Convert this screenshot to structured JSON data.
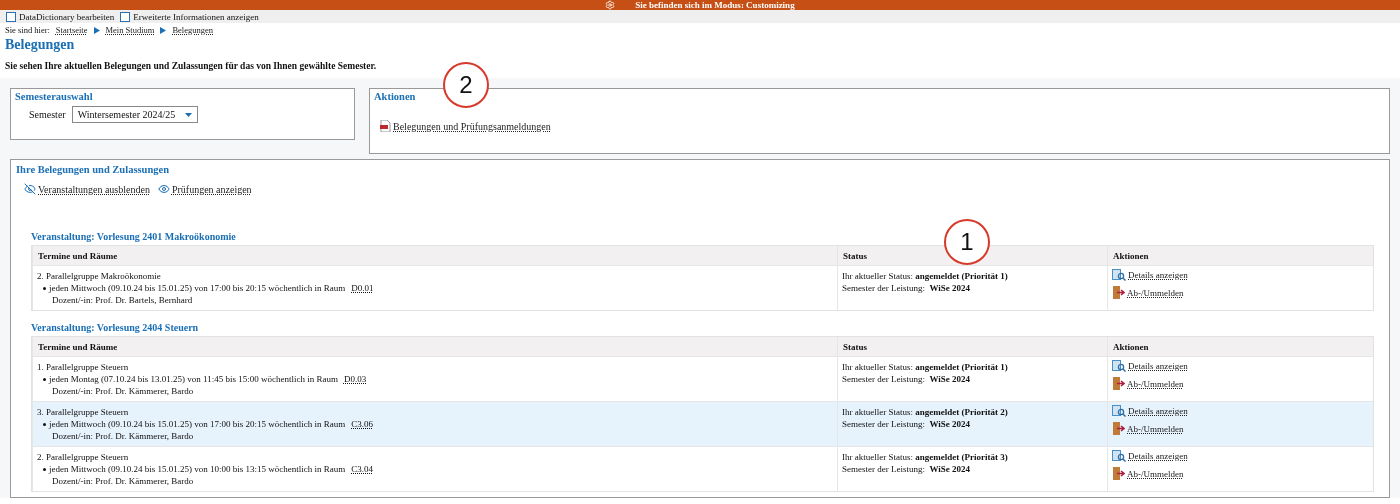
{
  "mode_bar": {
    "text": "Sie befinden sich im Modus: Customizing"
  },
  "options": [
    {
      "label": "DataDictionary bearbeiten",
      "checked": false
    },
    {
      "label": "Erweiterte Informationen anzeigen",
      "checked": false
    }
  ],
  "breadcrumb": {
    "label": "Sie sind hier:",
    "items": [
      "Startseite",
      "Mein Studium",
      "Belegungen"
    ]
  },
  "title": "Belegungen",
  "intro": "Sie sehen Ihre aktuellen Belegungen und Zulassungen für das von Ihnen gewählte Semester.",
  "semester_panel": {
    "title": "Semesterauswahl",
    "label": "Semester",
    "value": "Wintersemester 2024/25"
  },
  "actions_panel": {
    "title": "Aktionen",
    "link": "Belegungen und Prüfungsanmeldungen"
  },
  "enrollments": {
    "title": "Ihre Belegungen und Zulassungen",
    "toggles": [
      {
        "label": "Veranstaltungen ausblenden",
        "kind": "hide"
      },
      {
        "label": "Prüfungen anzeigen",
        "kind": "show"
      }
    ],
    "courses": [
      {
        "heading": "Veranstaltung: Vorlesung 2401 Makroökonomie",
        "columns": [
          "Termine und Räume",
          "Status",
          "Aktionen"
        ],
        "rows": [
          {
            "group": "2. Parallelgruppe Makroökonomie",
            "schedule": "jeden Mittwoch (09.10.24 bis 15.01.25) von 17:00 bis 20:15 wöchentlich in Raum",
            "room": "D0.01",
            "lecturer": "Dozent/-in: Prof. Dr. Bartels, Bernhard",
            "status_label": "Ihr aktueller Status:",
            "status": "angemeldet (Priorität 1)",
            "semester_label": "Semester der Leistung:",
            "semester": "WiSe 2024",
            "actions": [
              "Details anzeigen",
              "Ab-/Ummelden"
            ],
            "highlighted": false
          }
        ]
      },
      {
        "heading": "Veranstaltung: Vorlesung 2404 Steuern",
        "columns": [
          "Termine und Räume",
          "Status",
          "Aktionen"
        ],
        "rows": [
          {
            "group": "1. Parallelgruppe Steuern",
            "schedule": "jeden Montag (07.10.24 bis 13.01.25) von 11:45 bis 15:00 wöchentlich in Raum",
            "room": "D0.03",
            "lecturer": "Dozent/-in: Prof. Dr. Kämmerer, Bardo",
            "status_label": "Ihr aktueller Status:",
            "status": "angemeldet (Priorität 1)",
            "semester_label": "Semester der Leistung:",
            "semester": "WiSe 2024",
            "actions": [
              "Details anzeigen",
              "Ab-/Ummelden"
            ],
            "highlighted": false
          },
          {
            "group": "3. Parallelgruppe Steuern",
            "schedule": "jeden Mittwoch (09.10.24 bis 15.01.25) von 17:00 bis 20:15 wöchentlich in Raum",
            "room": "C3.06",
            "lecturer": "Dozent/-in: Prof. Dr. Kämmerer, Bardo",
            "status_label": "Ihr aktueller Status:",
            "status": "angemeldet (Priorität 2)",
            "semester_label": "Semester der Leistung:",
            "semester": "WiSe 2024",
            "actions": [
              "Details anzeigen",
              "Ab-/Ummelden"
            ],
            "highlighted": true
          },
          {
            "group": "2. Parallelgruppe Steuern",
            "schedule": "jeden Mittwoch (09.10.24 bis 15.01.25) von 10:00 bis 13:15 wöchentlich in Raum",
            "room": "C3.04",
            "lecturer": "Dozent/-in: Prof. Dr. Kämmerer, Bardo",
            "status_label": "Ihr aktueller Status:",
            "status": "angemeldet (Priorität 3)",
            "semester_label": "Semester der Leistung:",
            "semester": "WiSe 2024",
            "actions": [
              "Details anzeigen",
              "Ab-/Ummelden"
            ],
            "highlighted": false
          }
        ]
      }
    ]
  },
  "annotations": [
    {
      "number": "2"
    },
    {
      "number": "1"
    }
  ]
}
